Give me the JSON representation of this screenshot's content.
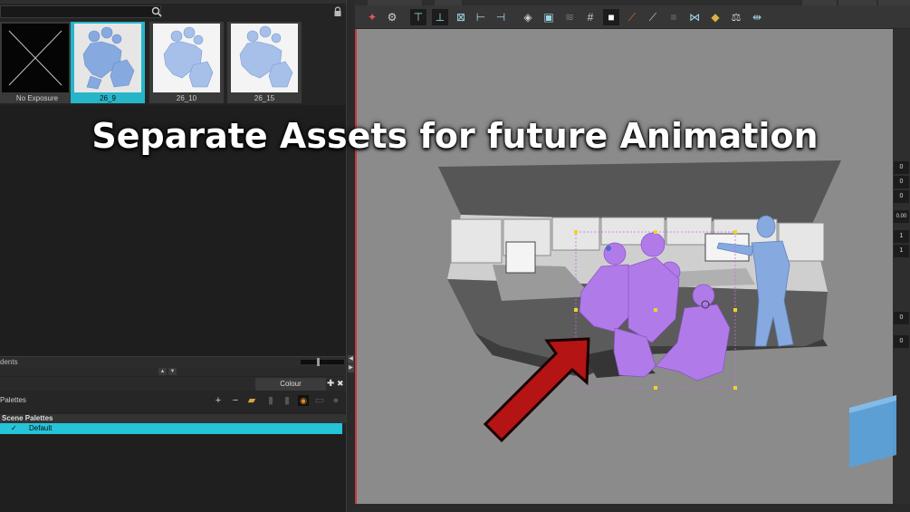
{
  "library": {
    "search_placeholder": "",
    "thumbnails": [
      {
        "label": "No Exposure",
        "selected": false,
        "empty": true
      },
      {
        "label": "26_9",
        "selected": true,
        "empty": false
      },
      {
        "label": "26_10",
        "selected": false,
        "empty": false
      },
      {
        "label": "26_15",
        "selected": false,
        "empty": false
      }
    ]
  },
  "timeline": {
    "label": "dents"
  },
  "colour_panel": {
    "tab_label": "Colour",
    "palettes_label": "Palettes",
    "scene_palettes_header": "Scene Palettes",
    "palette_name": "Default",
    "palette_check": "✓"
  },
  "caption": {
    "text": "Separate Assets for future Animation"
  },
  "side_values": [
    "0",
    "0",
    "0",
    "0.00",
    "1",
    "1",
    "0",
    "0"
  ],
  "colors": {
    "accent_cyan": "#26c4d8",
    "selection_purple": "#b07be8",
    "character_blue": "#86a9e0",
    "arrow_red": "#b41414",
    "logo_blue": "#5aa0d8"
  },
  "icons": [
    "search-icon",
    "lock-icon",
    "add-icon",
    "remove-icon",
    "folder-icon",
    "gear-icon",
    "grid-icon",
    "pencil-icon",
    "arrow-icon"
  ]
}
